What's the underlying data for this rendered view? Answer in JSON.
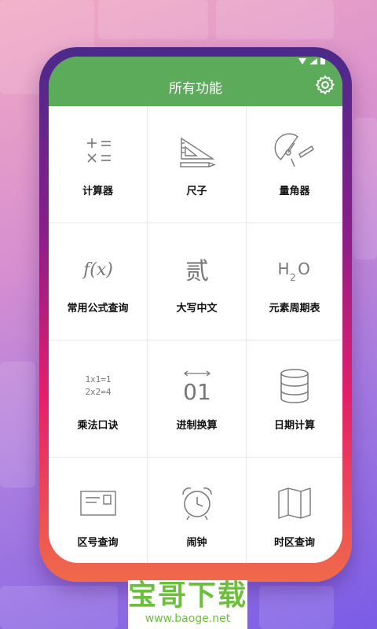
{
  "header": {
    "title": "所有功能",
    "settings_icon": "gear-icon"
  },
  "tools": [
    {
      "label": "计算器",
      "icon": "calculator-icon"
    },
    {
      "label": "尺子",
      "icon": "ruler-icon"
    },
    {
      "label": "量角器",
      "icon": "protractor-icon"
    },
    {
      "label": "常用公式查询",
      "icon": "formula-icon"
    },
    {
      "label": "大写中文",
      "icon": "chinese-numeral-icon"
    },
    {
      "label": "元素周期表",
      "icon": "periodic-table-icon"
    },
    {
      "label": "乘法口诀",
      "icon": "multiplication-table-icon"
    },
    {
      "label": "进制换算",
      "icon": "base-conversion-icon"
    },
    {
      "label": "日期计算",
      "icon": "database-icon"
    },
    {
      "label": "区号查询",
      "icon": "area-code-icon"
    },
    {
      "label": "闹钟",
      "icon": "alarm-clock-icon"
    },
    {
      "label": "时区查询",
      "icon": "map-icon"
    }
  ],
  "icon_text": {
    "formula": "f(x)",
    "chinese": "贰",
    "h2o_h": "H",
    "h2o_2": "2",
    "h2o_o": "O",
    "mult1": "1x1=1",
    "mult2": "2x2=4",
    "base": "01"
  },
  "watermark": {
    "brand": "宝哥下载",
    "url": "www.baoge.net"
  },
  "colors": {
    "header_green": "#5cab5a",
    "watermark_green": "#6bbf3a"
  }
}
